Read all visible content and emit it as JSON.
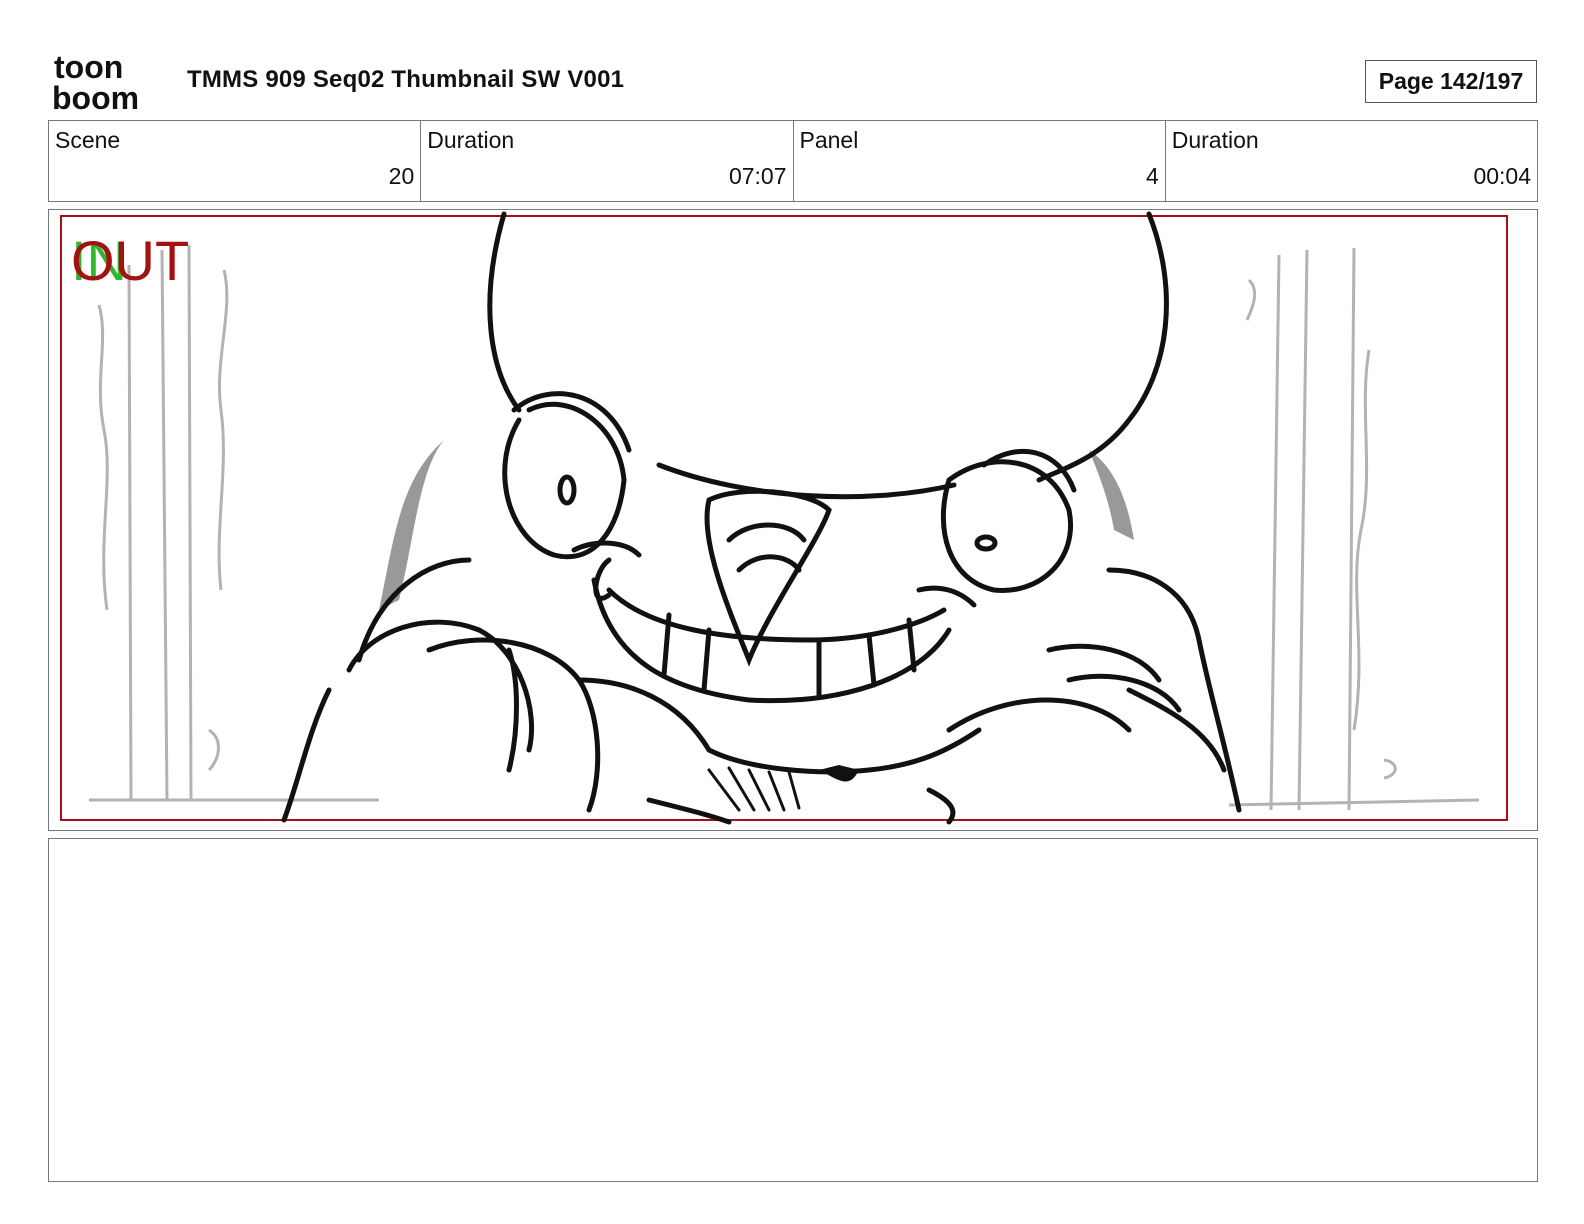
{
  "header": {
    "logo": {
      "line1": "toon",
      "line2": "boom",
      "icon": "toon-boom-logo"
    },
    "title": "TMMS 909 Seq02 Thumbnail SW V001",
    "page": "Page 142/197"
  },
  "info": {
    "scene_label": "Scene",
    "scene_value": "20",
    "scene_duration_label": "Duration",
    "scene_duration_value": "07:07",
    "panel_label": "Panel",
    "panel_value": "4",
    "panel_duration_label": "Duration",
    "panel_duration_value": "00:04"
  },
  "panel": {
    "in_marker": "IN",
    "out_marker": "OUT",
    "drawing": "grinning-character-sketch"
  },
  "colors": {
    "in_marker": "#2fb52f",
    "out_marker": "#a31212",
    "safe_frame": "#a31212"
  }
}
